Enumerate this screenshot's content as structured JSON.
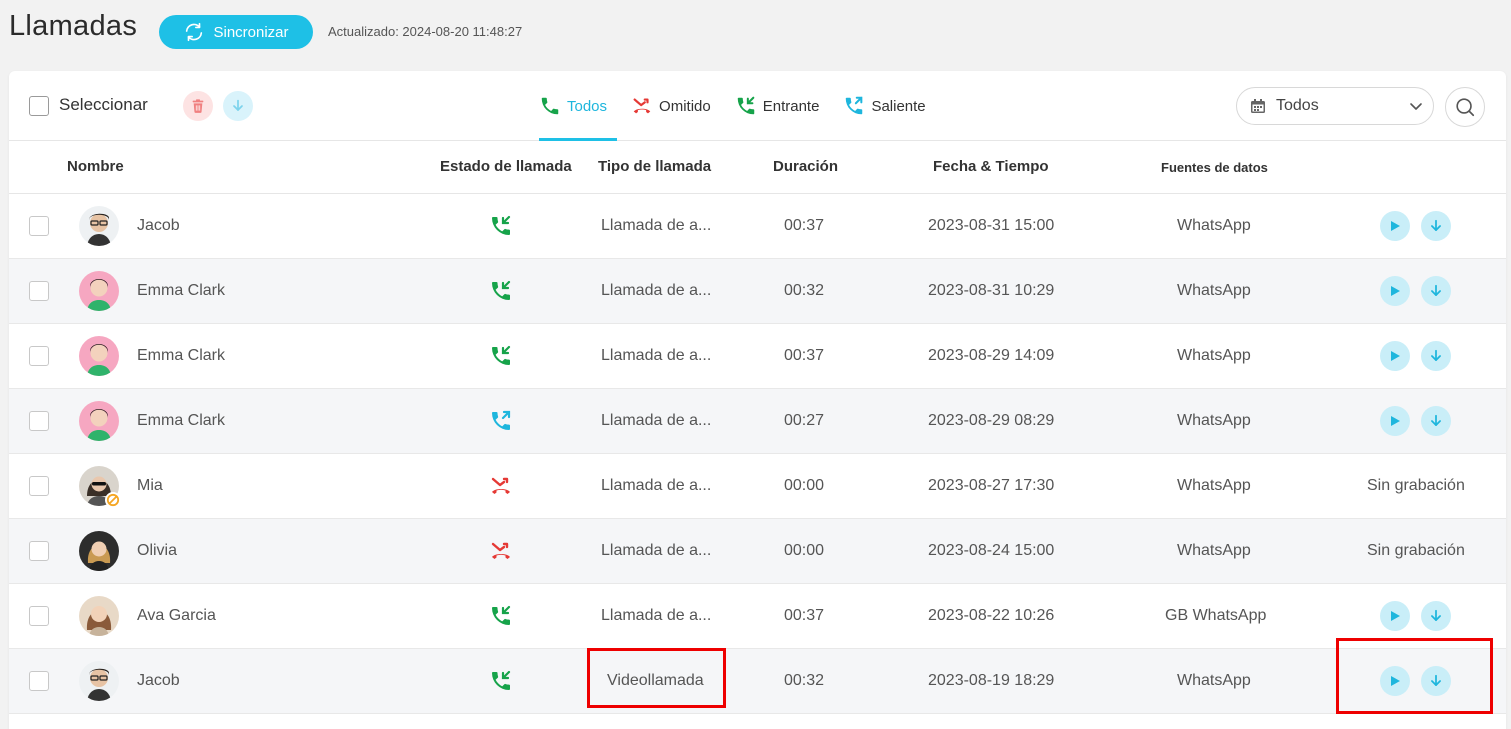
{
  "header": {
    "title": "Llamadas",
    "sync_label": "Sincronizar",
    "updated": "Actualizado: 2024-08-20 11:48:27"
  },
  "toolbar": {
    "select_label": "Seleccionar",
    "tabs": [
      {
        "label": "Todos",
        "icon": "phone-icon",
        "active": true
      },
      {
        "label": "Omitido",
        "icon": "missed-call-icon",
        "active": false
      },
      {
        "label": "Entrante",
        "icon": "incoming-call-icon",
        "active": false
      },
      {
        "label": "Saliente",
        "icon": "outgoing-call-icon",
        "active": false
      }
    ],
    "date_filter": "Todos"
  },
  "columns": {
    "name": "Nombre",
    "status": "Estado de llamada",
    "type": "Tipo de llamada",
    "duration": "Duración",
    "datetime": "Fecha & Tiempo",
    "source": "Fuentes de datos"
  },
  "rows": [
    {
      "name": "Jacob",
      "status": "incoming",
      "type": "Llamada de a...",
      "duration": "00:37",
      "datetime": "2023-08-31 15:00",
      "source": "WhatsApp",
      "actions": ""
    },
    {
      "name": "Emma Clark",
      "status": "incoming",
      "type": "Llamada de a...",
      "duration": "00:32",
      "datetime": "2023-08-31 10:29",
      "source": "WhatsApp",
      "actions": ""
    },
    {
      "name": "Emma Clark",
      "status": "incoming",
      "type": "Llamada de a...",
      "duration": "00:37",
      "datetime": "2023-08-29 14:09",
      "source": "WhatsApp",
      "actions": ""
    },
    {
      "name": "Emma Clark",
      "status": "outgoing",
      "type": "Llamada de a...",
      "duration": "00:27",
      "datetime": "2023-08-29 08:29",
      "source": "WhatsApp",
      "actions": ""
    },
    {
      "name": "Mia",
      "status": "missed",
      "type": "Llamada de a...",
      "duration": "00:00",
      "datetime": "2023-08-27 17:30",
      "source": "WhatsApp",
      "actions": "Sin grabación"
    },
    {
      "name": "Olivia",
      "status": "missed",
      "type": "Llamada de a...",
      "duration": "00:00",
      "datetime": "2023-08-24 15:00",
      "source": "WhatsApp",
      "actions": "Sin grabación"
    },
    {
      "name": "Ava Garcia",
      "status": "incoming",
      "type": "Llamada de a...",
      "duration": "00:37",
      "datetime": "2023-08-22 10:26",
      "source": "GB WhatsApp",
      "actions": ""
    },
    {
      "name": "Jacob",
      "status": "incoming",
      "type": "Videollamada",
      "duration": "00:32",
      "datetime": "2023-08-19 18:29",
      "source": "WhatsApp",
      "actions": ""
    }
  ],
  "colors": {
    "accent": "#1ec0e6",
    "incoming": "#16a34a",
    "outgoing": "#1eb6dd",
    "missed": "#e53935",
    "highlight": "#e00000"
  }
}
